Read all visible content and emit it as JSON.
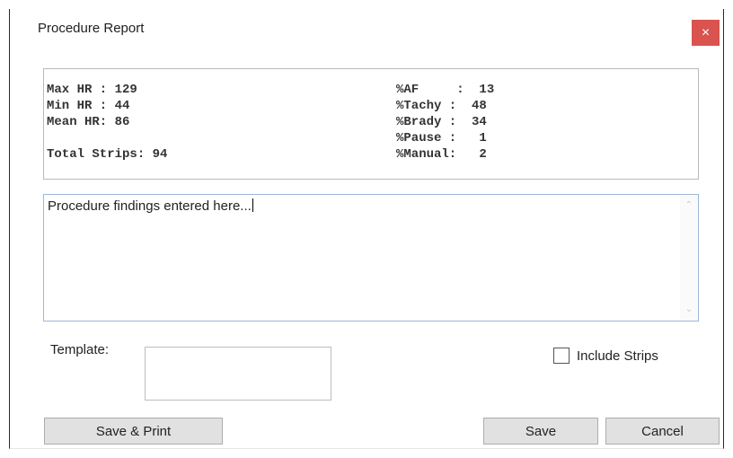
{
  "dialog": {
    "title": "Procedure Report",
    "close_label": "×"
  },
  "stats": {
    "left": [
      "Max HR : 129",
      "Min HR : 44",
      "Mean HR: 86",
      "",
      "Total Strips: 94"
    ],
    "right": [
      "%AF     :  13",
      "%Tachy :  48",
      "%Brady :  34",
      "%Pause :   1",
      "%Manual:   2"
    ]
  },
  "findings": {
    "value": "Procedure findings entered here..."
  },
  "template": {
    "label": "Template:",
    "value": ""
  },
  "include_strips": {
    "label": "Include Strips",
    "checked": false
  },
  "buttons": {
    "save_print": "Save & Print",
    "save": "Save",
    "cancel": "Cancel"
  },
  "colors": {
    "close_button": "#d9534f",
    "button_face": "#e1e1e1",
    "focus_border": "#9bb7d9"
  }
}
